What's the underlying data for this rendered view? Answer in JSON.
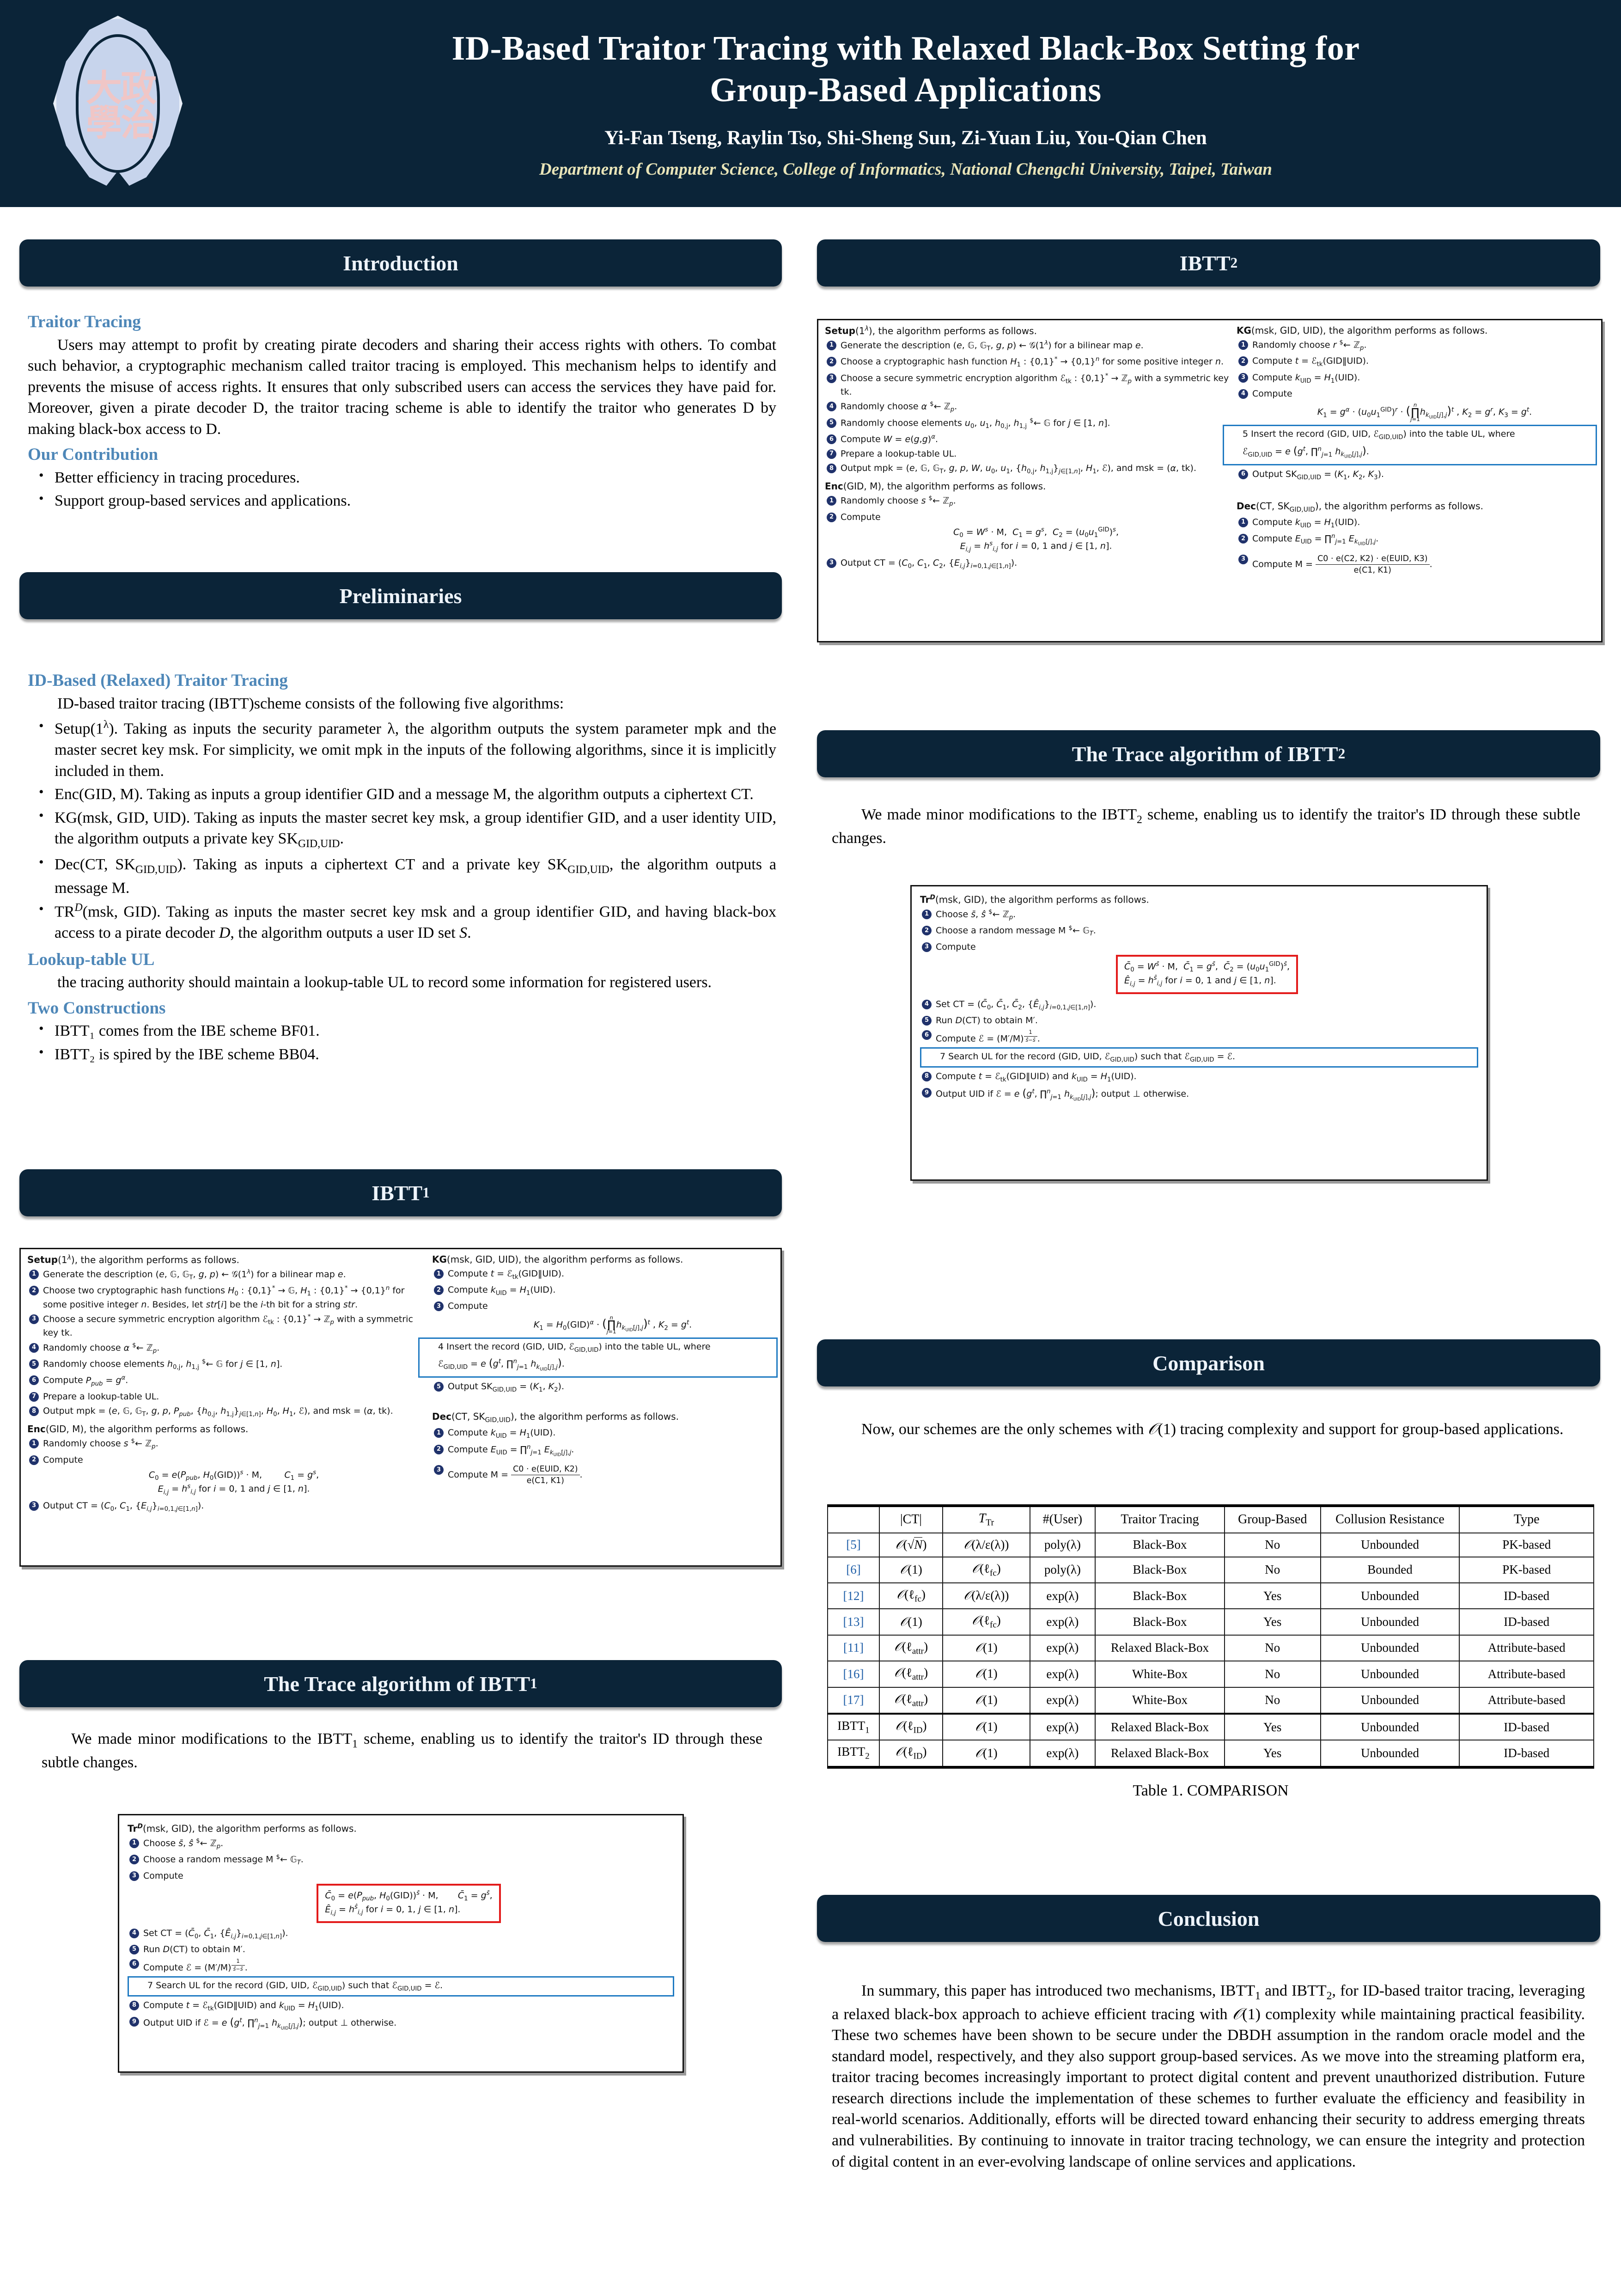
{
  "header": {
    "title_line1": "ID-Based Traitor Tracing with Relaxed Black-Box Setting for",
    "title_line2": "Group-Based Applications",
    "authors": "Yi-Fan Tseng, Raylin Tso, Shi-Sheng Sun, Zi-Yuan Liu, You-Qian Chen",
    "affiliation": "Department of Computer Science, College of Informatics, National Chengchi University, Taipei, Taiwan",
    "logo_glyph": "政治大學",
    "brand_color": "#0b2438",
    "accent_color": "#4e87b8"
  },
  "sections": {
    "introduction": "Introduction",
    "preliminaries": "Preliminaries",
    "ibtt1": "IBTT",
    "ibtt1_sub": "1",
    "ibtt2": "IBTT",
    "ibtt2_sub": "2",
    "trace1": "The Trace algorithm of IBTT",
    "trace1_sub": "1",
    "trace2": "The Trace algorithm of IBTT",
    "trace2_sub": "2",
    "comparison": "Comparison",
    "conclusion": "Conclusion"
  },
  "introduction": {
    "traitor_tracing_head": "Traitor Tracing",
    "traitor_tracing_body": "Users may attempt to profit by creating pirate decoders and sharing their access rights with others. To combat such behavior, a cryptographic mechanism called traitor tracing is employed. This mechanism helps to identify and prevents the misuse of access rights. It ensures that only subscribed users can access the services they have paid for. Moreover, given a pirate decoder D, the traitor tracing scheme is able to identify the traitor who generates D by making black-box access to D.",
    "contribution_head": "Our Contribution",
    "contribution_items": [
      "Better efficiency in tracing procedures.",
      "Support group-based services and applications."
    ]
  },
  "preliminaries": {
    "idbtt_head": "ID-Based (Relaxed) Traitor Tracing",
    "idbtt_intro": "ID-based traitor tracing (IBTT)scheme consists of the following five algorithms:",
    "algorithms": [
      "Setup(1λ). Taking as inputs the security parameter λ, the algorithm outputs the system parameter mpk and the master secret key msk. For simplicity, we omit mpk in the inputs of the following algorithms, since it is implicitly included in them.",
      "Enc(GID, M). Taking as inputs a group identifier GID and a message M, the algorithm outputs a ciphertext CT.",
      "KG(msk, GID, UID). Taking as inputs the master secret key msk, a group identifier GID, and a user identity UID, the algorithm outputs a private key SK GID,UID.",
      "Dec(CT, SK GID,UID). Taking as inputs a ciphertext CT and a private key SK GID,UID, the algorithm outputs a message M.",
      "TR D (msk, GID). Taking as inputs the master secret key msk and a group identifier GID, and having black-box access to a pirate decoder D, the algorithm outputs a user ID set S."
    ],
    "lookup_head": "Lookup-table UL",
    "lookup_body": "the tracing authority should maintain a lookup-table UL to record some information for registered users.",
    "constructions_head": "Two Constructions",
    "constructions_items": [
      "IBTT₁ comes from the IBE scheme BF01.",
      "IBTT₂ is spired by the IBE scheme BB04."
    ]
  },
  "ibtt1": {
    "setup_title": "Setup(1λ), the algorithm performs as follows.",
    "setup_steps": [
      "Generate the description (e, G, GT, g, p) ← G(1λ) for a bilinear map e.",
      "Choose two cryptographic hash functions H0 : {0,1}* → G, H1 : {0,1}* → {0,1}ⁿ for some positive integer n. Besides, let str[i] be the i-th bit for a string str.",
      "Choose a secure symmetric encryption algorithm ℰtk : {0,1}* → ℤp with a symmetric key tk.",
      "Randomly choose α ←$ ℤp.",
      "Randomly choose elements h0,j, h1,j ←$ G for j ∈ [1, n].",
      "Compute Ppub = gα.",
      "Prepare a lookup-table UL.",
      "Output mpk = (e, G, GT, g, p, Ppub, {h0,j, h1,j}j∈[1,n], H0, H1, ℰ), and msk = (α, tk)."
    ],
    "enc_title": "Enc(GID, M), the algorithm performs as follows.",
    "enc_steps": [
      "Randomly choose s ←$ ℤp.",
      "Compute",
      "Output CT = (C0, C1, {Ei,j}i=0,1,j∈[1,n])."
    ],
    "enc_eq1": "C0 = e(Ppub, H0(GID))s · M,",
    "enc_eq1b": "C1 = gs,",
    "enc_eq2": "Ei,j = hsi,j for i = 0, 1 and j ∈ [1, n].",
    "kg_title": "KG(msk, GID, UID), the algorithm performs as follows.",
    "kg_steps": [
      "Compute t = ℰtk(GID‖UID).",
      "Compute kUID = H1(UID).",
      "Compute",
      "Insert the record (GID, UID, ℐGID,UID) into the table UL, where ℐGID,UID = e(gt, ∏nj=1 hkUID[j],j).",
      "Output SKGID,UID = (K1, K2)."
    ],
    "kg_eq": "K1 = H0(GID)α · (∏nj=1 hkUID[j],j)t , K2 = gt.",
    "dec_title": "Dec(CT, SKGID,UID), the algorithm performs as follows.",
    "dec_steps": [
      "Compute kUID = H1(UID).",
      "Compute EUID = ∏nj=1 EkUID[j],j.",
      "Compute M ="
    ],
    "dec_frac_num": "C0 · e(EUID, K2)",
    "dec_frac_den": "e(C1, K1)"
  },
  "ibtt2": {
    "setup_title": "Setup(1λ), the algorithm performs as follows.",
    "setup_steps": [
      "Generate the description (e, G, GT, g, p) ← G(1λ) for a bilinear map e.",
      "Choose a cryptographic hash function H1 : {0,1}* → {0,1}ⁿ for some positive integer n.",
      "Choose a secure symmetric encryption algorithm ℰtk : {0,1}* → ℤp with a symmetric key tk.",
      "Randomly choose α ←$ ℤp.",
      "Randomly choose elements u0, u1, h0,j, h1,j ←$ G for j ∈ [1, n].",
      "Compute W = e(g,g)α.",
      "Prepare a lookup-table UL.",
      "Output mpk = (e, G, GT, g, p, W, u0, u1, {h0,j, h1,j}j∈[1,n], H1, ℰ), and msk = (α, tk)."
    ],
    "enc_title": "Enc(GID, M), the algorithm performs as follows.",
    "enc_steps": [
      "Randomly choose s ←$ ℤp.",
      "Compute",
      "Output CT = (C0, C1, C2, {Ei,j}i=0,1,j∈[1,n])."
    ],
    "enc_eq1": "C0 = Ws · M,  C1 = gs,  C2 = (u0u1GID)s,",
    "enc_eq2": "Ei,j = hsi,j for i = 0, 1 and j ∈ [1, n].",
    "kg_title": "KG(msk, GID, UID), the algorithm performs as follows.",
    "kg_steps": [
      "Randomly choose r ←$ ℤp.",
      "Compute t = ℰtk(GID‖UID).",
      "Compute kUID = H1(UID).",
      "Compute",
      "Insert the record (GID, UID, ℐGID,UID) into the table UL, where ℐGID,UID = e(gt, ∏nj=1 hkUID[j],j).",
      "Output SKGID,UID = (K1, K2, K3)."
    ],
    "kg_eq": "K1 = gα · (u0u1GID)r · (∏nj=1 hkUID[j],j)t , K2 = gr, K3 = gt.",
    "dec_title": "Dec(CT, SKGID,UID), the algorithm performs as follows.",
    "dec_steps": [
      "Compute kUID = H1(UID).",
      "Compute EUID = ∏nj=1 EkUID[j],j.",
      "Compute M ="
    ],
    "dec_frac_num": "C0 · e(C2, K2) · e(EUID, K3)",
    "dec_frac_den": "e(C1, K1)"
  },
  "trace1": {
    "intro": "We made minor modifications to the IBTT₁ scheme, enabling us to identify the traitor's ID through these subtle changes.",
    "title": "Trᴰ(msk, GID), the algorithm performs as follows.",
    "steps": [
      "Choose s̄, ŝ ←$ ℤp.",
      "Choose a random message M ←$ GT.",
      "Compute",
      "Set CT = (C̄0, C̄1, {Êij}i=0,1,j∈[1,n]).",
      "Run D(CT) to obtain M′.",
      "Compute ℐ = (M′/M)1/(ŝ−s̄).",
      "Search UL for the record (GID, UID, ℐGID,UID) such that ℐGID,UID = ℐ.",
      "Compute t = ℰtk(GID‖UID) and kUID = H1(UID).",
      "Output UID if ℐ = e(gt, ∏nj=1 hkUID[j],j); output ⊥ otherwise."
    ],
    "eq1": "C̄0 = e(Ppub, H0(GID))s̄ · M,",
    "eq1b": "C̄1 = gs̄,",
    "eq2": "Êij = hŝi,j for i = 0, 1, j ∈ [1, n]."
  },
  "trace2": {
    "intro": "We made minor modifications to the IBTT₂ scheme, enabling us to identify the traitor's ID through these subtle changes.",
    "title": "Trᴰ(msk, GID), the algorithm performs as follows.",
    "steps": [
      "Choose s̄, ŝ ←$ ℤp.",
      "Choose a random message M ←$ GT.",
      "Compute",
      "Set CT = (C̄0, C̄1, C̄2, {Êij}i=0,1,j∈[1,n]).",
      "Run D(CT) to obtain M′.",
      "Compute ℐ = (M′/M)1/(ŝ−s̄).",
      "Search UL for the record (GID, UID, ℐGID,UID) such that ℐGID,UID = ℐ.",
      "Compute t = ℰtk(GID‖UID) and kUID = H1(UID).",
      "Output UID if ℐ = e(gt, ∏nj=1 hkUID[j],j); output ⊥ otherwise."
    ],
    "eq1": "C̄0 = Ws̄ · M,  C̄1 = gs̄,  C̄2 = (u0u1GID)s̄,",
    "eq2": "Êij = hŝi,j for i = 0, 1 and j ∈ [1, n]."
  },
  "comparison": {
    "intro": "Now, our schemes are the only schemes with ᵊ(1) tracing complexity and support for group-based applications.",
    "caption": "Table 1. COMPARISON",
    "columns": [
      "",
      "|CT|",
      "T Tr",
      "#(User)",
      "Traitor Tracing",
      "Group-Based",
      "Collusion Resistance",
      "Type"
    ],
    "rows": [
      {
        "ref": "[5]",
        "ct": "ᵊ(√N)",
        "ttr": "ᵊ(λ/ϵ(λ))",
        "users": "poly(λ)",
        "tracing": "Black-Box",
        "group": "No",
        "collusion": "Unbounded",
        "type": "PK-based"
      },
      {
        "ref": "[6]",
        "ct": "ᵊ(1)",
        "ttr": "ᵊ(ℓfc)",
        "users": "poly(λ)",
        "tracing": "Black-Box",
        "group": "No",
        "collusion": "Bounded",
        "type": "PK-based"
      },
      {
        "ref": "[12]",
        "ct": "ᵊ(ℓfc)",
        "ttr": "ᵊ(λ/ϵ(λ))",
        "users": "exp(λ)",
        "tracing": "Black-Box",
        "group": "Yes",
        "collusion": "Unbounded",
        "type": "ID-based"
      },
      {
        "ref": "[13]",
        "ct": "ᵊ(1)",
        "ttr": "ᵊ(ℓfc)",
        "users": "exp(λ)",
        "tracing": "Black-Box",
        "group": "Yes",
        "collusion": "Unbounded",
        "type": "ID-based"
      },
      {
        "ref": "[11]",
        "ct": "ᵊ(ℓattr)",
        "ttr": "ᵊ(1)",
        "users": "exp(λ)",
        "tracing": "Relaxed Black-Box",
        "group": "No",
        "collusion": "Unbounded",
        "type": "Attribute-based"
      },
      {
        "ref": "[16]",
        "ct": "ᵊ(ℓattr)",
        "ttr": "ᵊ(1)",
        "users": "exp(λ)",
        "tracing": "White-Box",
        "group": "No",
        "collusion": "Unbounded",
        "type": "Attribute-based"
      },
      {
        "ref": "[17]",
        "ct": "ᵊ(ℓattr)",
        "ttr": "ᵊ(1)",
        "users": "exp(λ)",
        "tracing": "White-Box",
        "group": "No",
        "collusion": "Unbounded",
        "type": "Attribute-based"
      },
      {
        "ref": "IBTT₁",
        "ct": "ᵊ(ℓID)",
        "ttr": "ᵊ(1)",
        "users": "exp(λ)",
        "tracing": "Relaxed Black-Box",
        "group": "Yes",
        "collusion": "Unbounded",
        "type": "ID-based"
      },
      {
        "ref": "IBTT₂",
        "ct": "ᵊ(ℓID)",
        "ttr": "ᵊ(1)",
        "users": "exp(λ)",
        "tracing": "Relaxed Black-Box",
        "group": "Yes",
        "collusion": "Unbounded",
        "type": "ID-based"
      }
    ]
  },
  "conclusion": {
    "body": "In summary, this paper has introduced two mechanisms, IBTT₁ and IBTT₂, for ID-based traitor tracing, leveraging a relaxed black-box approach to achieve efficient tracing with ᵊ(1) complexity while maintaining practical feasibility. These two schemes have been shown to be secure under the DBDH assumption in the random oracle model and the standard model, respectively, and they also support group-based services. As we move into the streaming platform era, traitor tracing becomes increasingly important to protect digital content and prevent unauthorized distribution. Future research directions include the implementation of these schemes to further evaluate the efficiency and feasibility in real-world scenarios. Additionally, efforts will be directed toward enhancing their security to address emerging threats and vulnerabilities. By continuing to innovate in traitor tracing technology, we can ensure the integrity and protection of digital content in an ever-evolving landscape of online services and applications."
  }
}
